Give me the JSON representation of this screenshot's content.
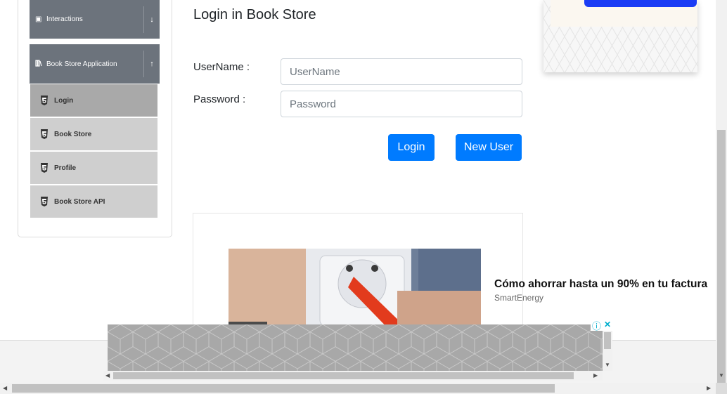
{
  "sidebar": {
    "groups": [
      {
        "label": "Interactions",
        "toggle": "↓"
      },
      {
        "label": "Book Store Application",
        "toggle": "↑"
      }
    ],
    "items": [
      {
        "label": "Login"
      },
      {
        "label": "Book Store"
      },
      {
        "label": "Profile"
      },
      {
        "label": "Book Store API"
      }
    ]
  },
  "main": {
    "title": "Login in Book Store",
    "username_label": "UserName :",
    "username_placeholder": "UserName",
    "username_value": "",
    "password_label": "Password :",
    "password_placeholder": "Password",
    "password_value": "",
    "login_button": "Login",
    "new_user_button": "New User"
  },
  "ad": {
    "headline": "Cómo ahorrar hasta un 90% en tu factura",
    "source": "SmartEnergy",
    "info_icon": "ⓘ",
    "close_icon": "✕"
  },
  "colors": {
    "primary": "#007bff",
    "sidebar_header": "#6c737c",
    "menu_item": "#cfcfcf",
    "menu_item_active": "#a9a9a9"
  }
}
